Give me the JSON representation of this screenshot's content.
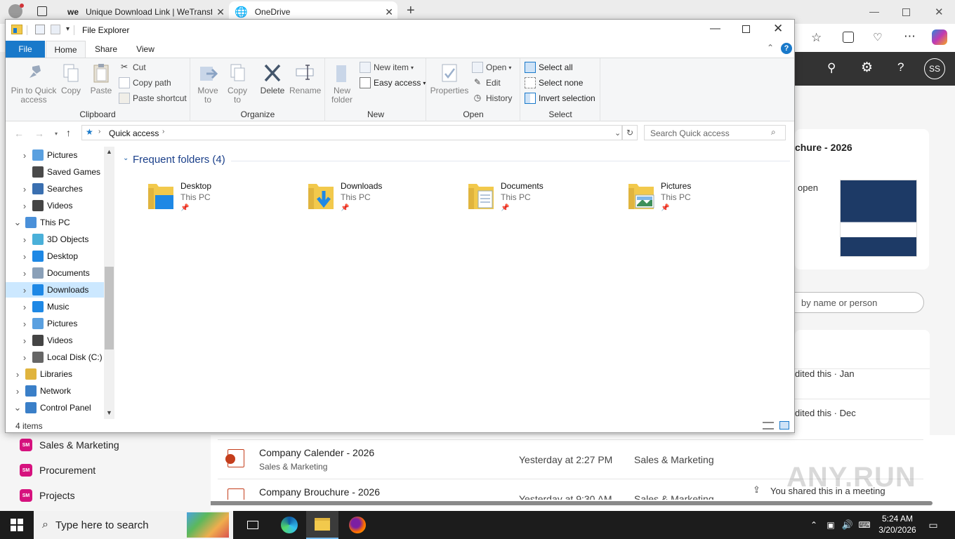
{
  "browser": {
    "tabs": [
      {
        "title": "Unique Download Link | WeTransf"
      },
      {
        "title": "OneDrive"
      }
    ],
    "profile_initials": "SS"
  },
  "onedrive": {
    "card_title": "chure - 2026",
    "card_line": "open",
    "search_placeholder": "by name or person",
    "activity": [
      {
        "text": "dited this · Jan"
      },
      {
        "text": "dited this · Dec"
      }
    ],
    "sites": [
      {
        "label": "Sales & Marketing",
        "initials": "SM"
      },
      {
        "label": "Procurement",
        "initials": "SM"
      },
      {
        "label": "Projects",
        "initials": "SM"
      }
    ],
    "files": [
      {
        "name": "Company Calender - 2026",
        "location": "Sales & Marketing",
        "modified": "Yesterday at 2:27 PM",
        "site": "Sales & Marketing",
        "activity": ""
      },
      {
        "name": "Company Brouchure - 2026",
        "location": "",
        "modified": "Yesterday at 9:30 AM",
        "site": "Sales & Marketing",
        "activity": "You shared this in a meeting"
      }
    ]
  },
  "explorer": {
    "title": "File Explorer",
    "ribbon_tabs": [
      "File",
      "Home",
      "Share",
      "View"
    ],
    "clipboard": {
      "label": "Clipboard",
      "pin": "Pin to Quick access",
      "copy": "Copy",
      "paste": "Paste",
      "cut": "Cut",
      "copy_path": "Copy path",
      "paste_shortcut": "Paste shortcut"
    },
    "organize": {
      "label": "Organize",
      "move_to": "Move to",
      "copy_to": "Copy to",
      "delete": "Delete",
      "rename": "Rename"
    },
    "new": {
      "label": "New",
      "new_folder": "New folder",
      "new_item": "New item",
      "easy_access": "Easy access"
    },
    "open": {
      "label": "Open",
      "properties": "Properties",
      "open": "Open",
      "edit": "Edit",
      "history": "History"
    },
    "select": {
      "label": "Select",
      "select_all": "Select all",
      "select_none": "Select none",
      "invert": "Invert selection"
    },
    "address": {
      "location": "Quick access",
      "search_placeholder": "Search Quick access"
    },
    "nav": [
      {
        "label": "Pictures",
        "indent": 1,
        "chev": ">"
      },
      {
        "label": "Saved Games",
        "indent": 1,
        "chev": ""
      },
      {
        "label": "Searches",
        "indent": 1,
        "chev": ">"
      },
      {
        "label": "Videos",
        "indent": 1,
        "chev": ">"
      },
      {
        "label": "This PC",
        "indent": 0,
        "chev": "v"
      },
      {
        "label": "3D Objects",
        "indent": 1,
        "chev": ">"
      },
      {
        "label": "Desktop",
        "indent": 1,
        "chev": ">"
      },
      {
        "label": "Documents",
        "indent": 1,
        "chev": ">"
      },
      {
        "label": "Downloads",
        "indent": 1,
        "chev": ">",
        "selected": true
      },
      {
        "label": "Music",
        "indent": 1,
        "chev": ">"
      },
      {
        "label": "Pictures",
        "indent": 1,
        "chev": ">"
      },
      {
        "label": "Videos",
        "indent": 1,
        "chev": ">"
      },
      {
        "label": "Local Disk (C:)",
        "indent": 1,
        "chev": ">"
      },
      {
        "label": "Libraries",
        "indent": 0,
        "chev": ">"
      },
      {
        "label": "Network",
        "indent": 0,
        "chev": ">"
      },
      {
        "label": "Control Panel",
        "indent": 0,
        "chev": "v"
      }
    ],
    "section_title": "Frequent folders (4)",
    "folders": [
      {
        "name": "Desktop",
        "location": "This PC"
      },
      {
        "name": "Downloads",
        "location": "This PC"
      },
      {
        "name": "Documents",
        "location": "This PC"
      },
      {
        "name": "Pictures",
        "location": "This PC"
      }
    ],
    "status": "4 items"
  },
  "taskbar": {
    "search_placeholder": "Type here to search",
    "time": "5:24 AM",
    "date": "3/20/2026"
  },
  "watermark": "ANY.RUN"
}
